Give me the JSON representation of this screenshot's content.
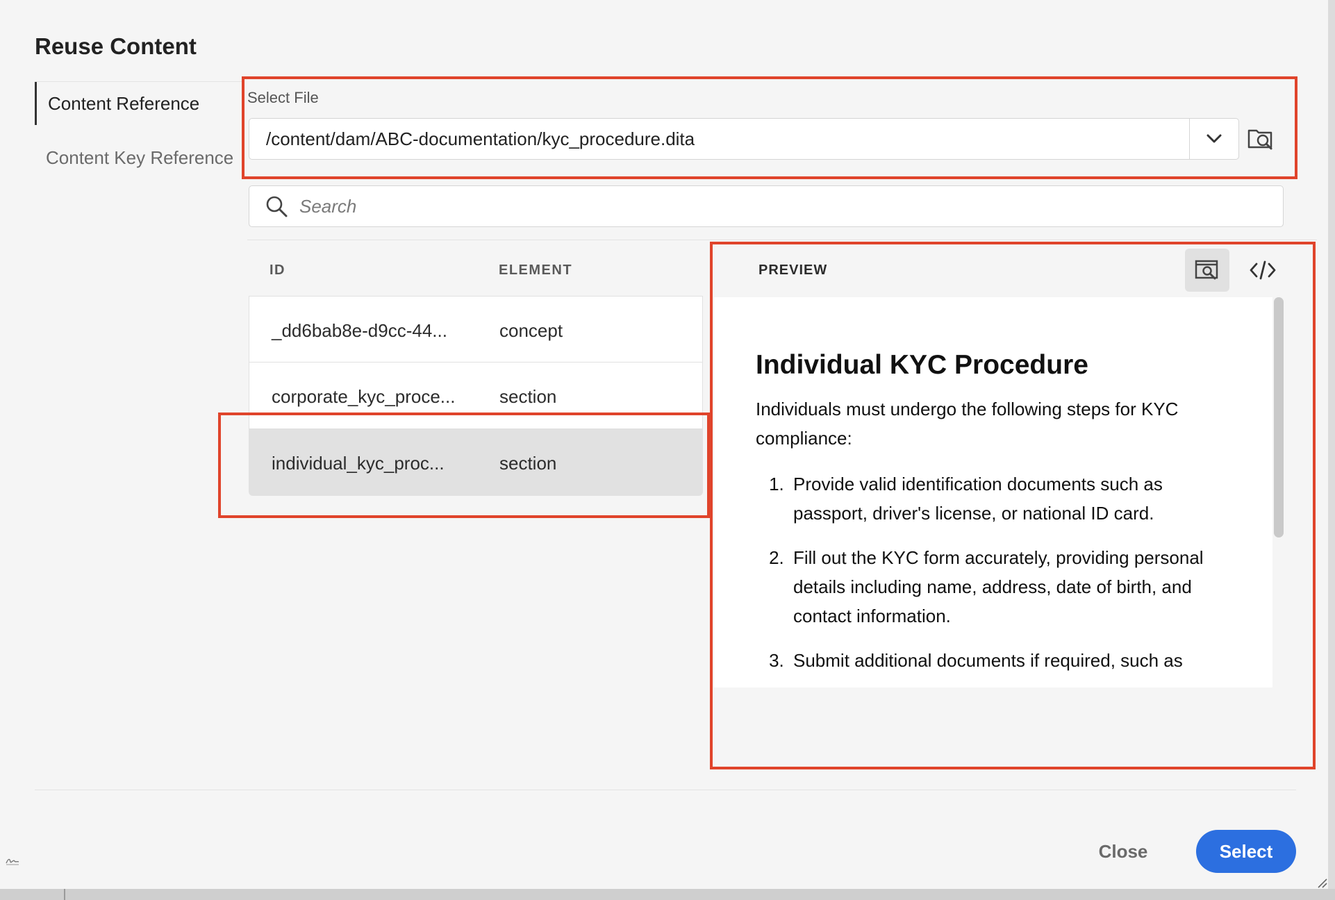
{
  "dialog": {
    "title": "Reuse Content"
  },
  "nav": {
    "items": [
      {
        "label": "Content Reference",
        "active": true
      },
      {
        "label": "Content Key Reference",
        "active": false
      }
    ]
  },
  "file": {
    "label": "Select File",
    "value": "/content/dam/ABC-documentation/kyc_procedure.dita",
    "dropdown_icon": "chevron-down-icon",
    "browse_icon": "folder-search-icon"
  },
  "search": {
    "placeholder": "Search",
    "icon": "search-icon"
  },
  "table": {
    "columns": [
      "ID",
      "ELEMENT"
    ],
    "rows": [
      {
        "id": "_dd6bab8e-d9cc-44...",
        "element": "concept"
      },
      {
        "id": "corporate_kyc_proce...",
        "element": "section"
      },
      {
        "id": "individual_kyc_proc...",
        "element": "section",
        "selected": true
      }
    ]
  },
  "preview": {
    "header": "PREVIEW",
    "view_icons": [
      "preview-icon",
      "code-icon"
    ],
    "title": "Individual KYC Procedure",
    "intro": "Individuals must undergo the following steps for KYC compliance:",
    "steps": [
      "Provide valid identification documents such as passport, driver's license, or national ID card.",
      "Fill out the KYC form accurately, providing personal details including name, address, date of birth, and contact information.",
      "Submit additional documents if required, such as"
    ]
  },
  "footer": {
    "close_label": "Close",
    "select_label": "Select"
  },
  "colors": {
    "accent": "#2c6fe0",
    "annotation": "#e0442b",
    "selected_row": "#e1e1e1",
    "background": "#f5f5f5"
  }
}
